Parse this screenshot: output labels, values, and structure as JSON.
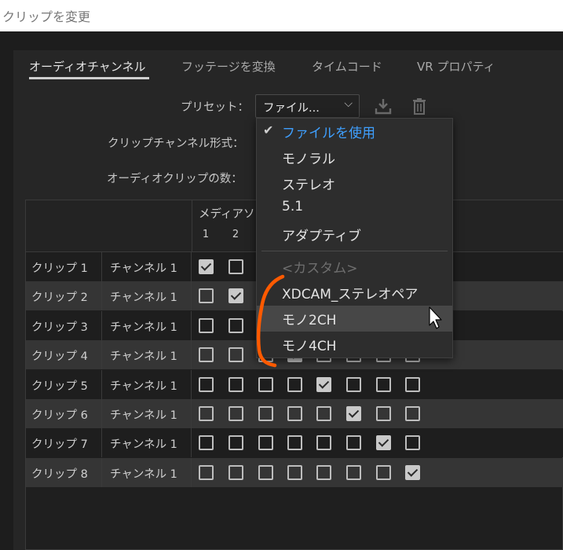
{
  "window": {
    "title": "クリップを変更"
  },
  "tabs": [
    {
      "label": "オーディオチャンネル",
      "active": true
    },
    {
      "label": "フッテージを変換"
    },
    {
      "label": "タイムコード"
    },
    {
      "label": "VR プロパティ"
    }
  ],
  "form": {
    "preset_label": "プリセット：",
    "preset_value": "ファイル...",
    "clip_channel_format_label": "クリップチャンネル形式：",
    "audio_clip_count_label": "オーディオクリップの数："
  },
  "grid": {
    "media_source_label": "メディアソ",
    "columns": [
      "1",
      "2"
    ],
    "rows": [
      {
        "clip": "クリップ 1",
        "channel": "チャンネル 1",
        "checked_col": 1
      },
      {
        "clip": "クリップ 2",
        "channel": "チャンネル 1",
        "checked_col": 2
      },
      {
        "clip": "クリップ 3",
        "channel": "チャンネル 1",
        "checked_col": 3
      },
      {
        "clip": "クリップ 4",
        "channel": "チャンネル 1",
        "checked_col": 4
      },
      {
        "clip": "クリップ 5",
        "channel": "チャンネル 1",
        "checked_col": 5
      },
      {
        "clip": "クリップ 6",
        "channel": "チャンネル 1",
        "checked_col": 6
      },
      {
        "clip": "クリップ 7",
        "channel": "チャンネル 1",
        "checked_col": 7
      },
      {
        "clip": "クリップ 8",
        "channel": "チャンネル 1",
        "checked_col": 8
      }
    ]
  },
  "preset_menu": {
    "items": [
      {
        "label": "ファイルを使用",
        "selected": true
      },
      {
        "label": "モノラル"
      },
      {
        "label": "ステレオ"
      },
      {
        "label": "5.1"
      },
      {
        "label": "アダプティブ"
      },
      {
        "label": "<カスタム>",
        "disabled": true
      },
      {
        "label": "XDCAM_ステレオペア"
      },
      {
        "label": "モノ2CH",
        "hovered": true
      },
      {
        "label": "モノ4CH"
      }
    ]
  },
  "icons": {
    "download": "download-icon",
    "trash": "trash-icon",
    "check": "checkmark-icon",
    "cursor": "mouse-pointer-icon"
  },
  "colors": {
    "accent_selected": "#3fa0ff",
    "annotation_stroke": "#ff5a00"
  }
}
